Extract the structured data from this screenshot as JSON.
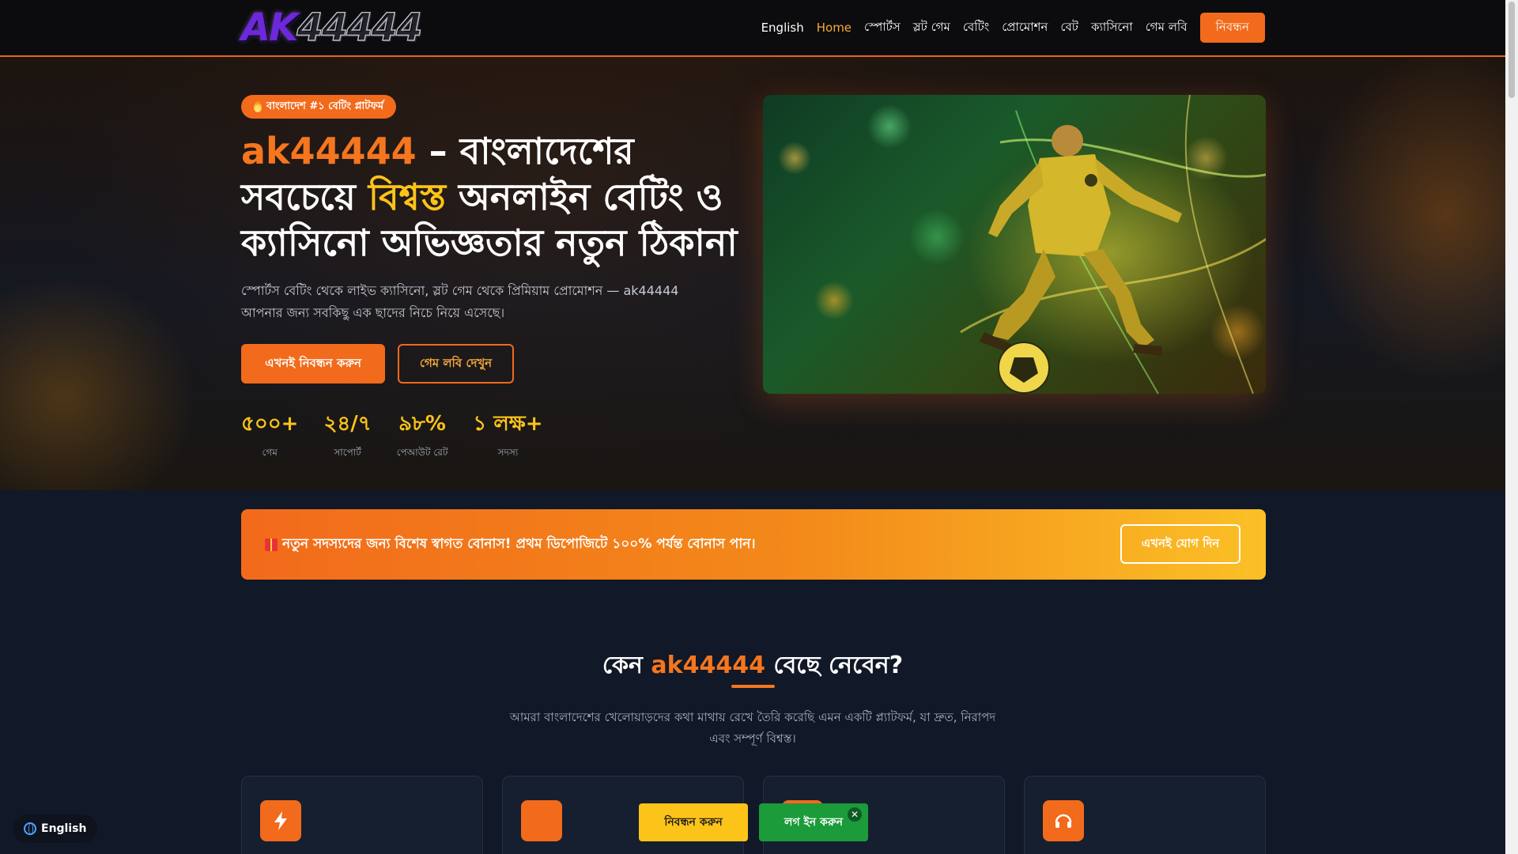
{
  "header": {
    "logo_ak": "AK",
    "logo_num": "44444",
    "nav": [
      {
        "label": "English"
      },
      {
        "label": "Home"
      },
      {
        "label": "স্পোর্টস"
      },
      {
        "label": "স্লট গেম"
      },
      {
        "label": "বেটিং"
      },
      {
        "label": "প্রোমোশন"
      },
      {
        "label": "বেট"
      },
      {
        "label": "ক্যাসিনো"
      },
      {
        "label": "গেম লবি"
      }
    ],
    "register_label": "নিবন্ধন",
    "active_color": "#f7a93a"
  },
  "hero": {
    "badge": "বাংলাদেশ #১ বেটিং প্লাটফর্ম",
    "title_brand": "ak44444",
    "title_part1": " – বাংলাদেশের সবচেয়ে ",
    "title_trusted": "বিশ্বস্ত",
    "title_part2": " অনলাইন বেটিং ও ক্যাসিনো অভিজ্ঞতার নতুন ঠিকানা",
    "description": "স্পোর্টস বেটিং থেকে লাইভ ক্যাসিনো, স্লট গেম থেকে প্রিমিয়াম প্রোমোশন — ak44444 আপনার জন্য সবকিছু এক ছাদের নিচে নিয়ে এসেছে।",
    "primary_button": "এখনই নিবন্ধন করুন",
    "secondary_button": "গেম লবি দেখুন",
    "stats": [
      {
        "value": "৫০০+",
        "label": "গেম"
      },
      {
        "value": "২৪/৭",
        "label": "সাপোর্ট"
      },
      {
        "value": "৯৮%",
        "label": "পেআউট রেট"
      },
      {
        "value": "১ লক্ষ+",
        "label": "সদস্য"
      }
    ]
  },
  "promo": {
    "text": "নতুন সদস্যদের জন্য বিশেষ স্বাগত বোনাস! প্রথম ডিপোজিটে ১০০% পর্যন্ত বোনাস পান।",
    "button": "এখনই যোগ দিন"
  },
  "why": {
    "title_part1": "কেন ",
    "title_brand": "ak44444",
    "title_part2": " বেছে নেবেন?",
    "description": "আমরা বাংলাদেশের খেলোয়াড়দের কথা মাথায় রেখে তৈরি করেছি এমন একটি প্ল্যাটফর্ম, যা দ্রুত, নিরাপদ এবং সম্পূর্ণ বিশ্বস্ত।",
    "cards": [
      {
        "icon": "lightning-icon"
      },
      {
        "icon": "shield-icon"
      },
      {
        "icon": "gift-icon"
      },
      {
        "icon": "headset-icon"
      }
    ]
  },
  "floating": {
    "language": "English",
    "register": "নিবন্ধন করুন",
    "login": "লগ ইন করুন",
    "close": "✕"
  },
  "colors": {
    "accent_orange": "#f26a1b",
    "accent_yellow": "#fcc419",
    "login_green": "#1b9b3a",
    "background": "#111827"
  }
}
